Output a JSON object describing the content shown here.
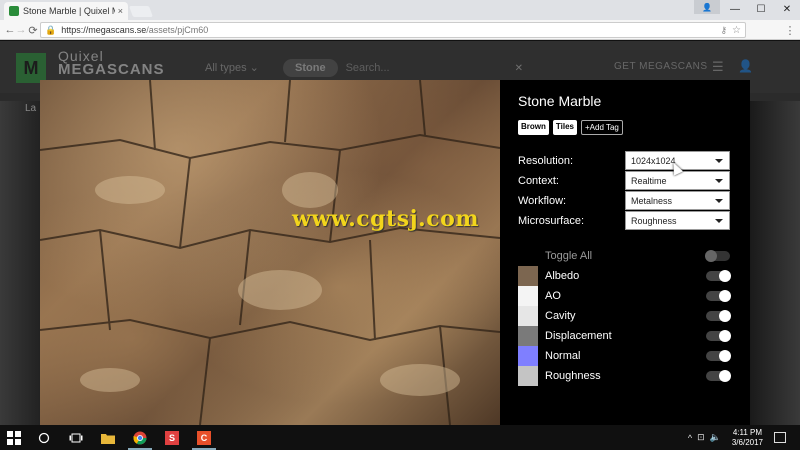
{
  "browser": {
    "tab_title": "Stone Marble | Quixel M",
    "tab_close": "×",
    "window_controls": {
      "minimize": "—",
      "maximize": "☐",
      "close": "✕"
    },
    "url_domain": "https://megascans.se",
    "url_path": "/assets/pjCm60",
    "nav": {
      "back": "←",
      "forward": "→",
      "reload": "⟳"
    }
  },
  "site": {
    "logo_mark": "M",
    "logo_line1": "Quixel",
    "logo_line2": "MEGASCANS",
    "filter_label": "All types",
    "filter_caret": "⌄",
    "search_chip": "Stone",
    "search_placeholder": "Search...",
    "search_clear": "✕",
    "get_button": "GET MEGASCANS",
    "left_fragment": "La"
  },
  "modal": {
    "title": "Stone Marble",
    "tags": [
      "Brown",
      "Tiles"
    ],
    "add_tag": "+Add Tag",
    "settings": [
      {
        "label": "Resolution:",
        "value": "1024x1024"
      },
      {
        "label": "Context:",
        "value": "Realtime"
      },
      {
        "label": "Workflow:",
        "value": "Metalness"
      },
      {
        "label": "Microsurface:",
        "value": "Roughness"
      }
    ],
    "toggle_all_label": "Toggle All",
    "maps": [
      {
        "name": "Albedo",
        "color": "#7c6650"
      },
      {
        "name": "AO",
        "color": "#f4f4f4"
      },
      {
        "name": "Cavity",
        "color": "#e6e6e6"
      },
      {
        "name": "Displacement",
        "color": "#7a7a7a"
      },
      {
        "name": "Normal",
        "color": "#7f7fff"
      },
      {
        "name": "Roughness",
        "color": "#c4c4c4"
      }
    ]
  },
  "watermark": "www.cgtsj.com",
  "taskbar": {
    "time": "4:11 PM",
    "date": "3/6/2017",
    "tray_caret": "^",
    "tray_network": "⊡",
    "tray_volume": "🔈"
  }
}
